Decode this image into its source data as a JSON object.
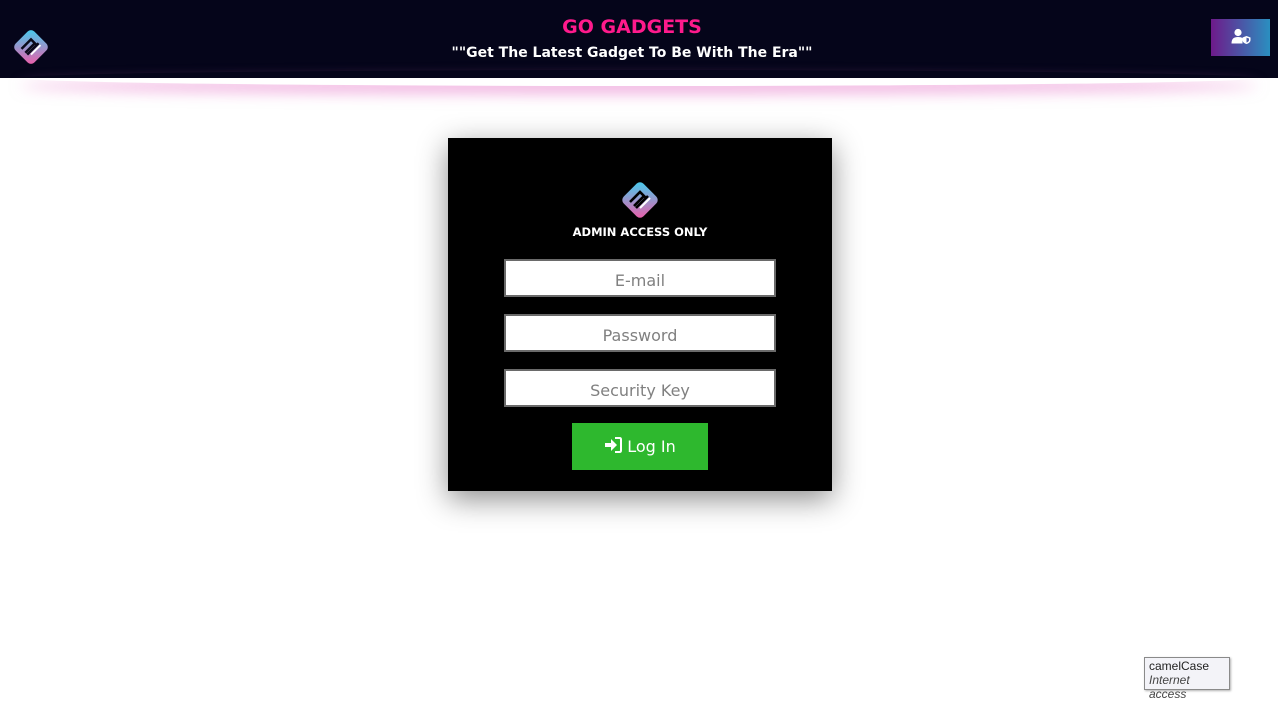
{
  "header": {
    "title": "GO GADGETS",
    "tagline": "\"\"Get The Latest Gadget To Be With The Era\"\"",
    "logo_icon": "go-gadgets-logo-icon",
    "admin_button_icon": "user-shield-icon",
    "background": "#05051a",
    "title_color": "#ff1a8c"
  },
  "login": {
    "heading": "ADMIN ACCESS ONLY",
    "email_placeholder": "E-mail",
    "password_placeholder": "Password",
    "security_key_placeholder": "Security Key",
    "submit_label": "Log In",
    "submit_icon": "sign-in-icon",
    "submit_color": "#2eb82e"
  },
  "tooltip": {
    "line1": "camelCase",
    "line2": "Internet access"
  }
}
